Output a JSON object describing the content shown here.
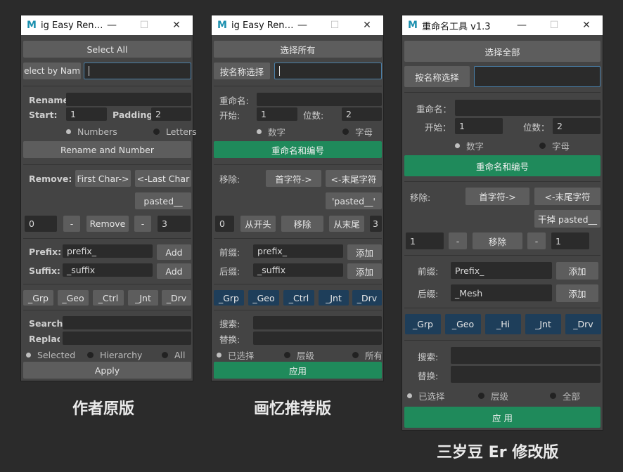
{
  "windows": [
    {
      "title": "ig Easy Ren…",
      "select_all": "Select All",
      "select_by_name": "elect by Nam",
      "rename_label": "Rename:",
      "start_label": "Start:",
      "start_value": "1",
      "padding_label": "Padding",
      "padding_value": "2",
      "opt_numbers": "Numbers",
      "opt_letters": "Letters",
      "rename_number": "Rename and Number",
      "remove_label": "Remove:",
      "first_char": "First Char->",
      "last_char": "<-Last Char",
      "pasted": "pasted__",
      "num_left": "0",
      "minus": "-",
      "remove_btn": "Remove",
      "num_right": "3",
      "prefix_label": "Prefix:",
      "prefix_value": "prefix_",
      "suffix_label": "Suffix:",
      "suffix_value": "_suffix",
      "add": "Add",
      "suffixes": [
        "_Grp",
        "_Geo",
        "_Ctrl",
        "_Jnt",
        "_Drv"
      ],
      "search_label": "Search:",
      "replace_label": "Replac",
      "scope": [
        "Selected",
        "Hierarchy",
        "All"
      ],
      "apply": "Apply",
      "caption": "作者原版"
    },
    {
      "title": "ig Easy Ren…",
      "select_all": "选择所有",
      "select_by_name": "按名称选择",
      "rename_label": "重命名:",
      "start_label": "开始:",
      "start_value": "1",
      "padding_label": "位数:",
      "padding_value": "2",
      "opt_numbers": "数字",
      "opt_letters": "字母",
      "rename_number": "重命名和编号",
      "remove_label": "移除:",
      "first_char": "首字符->",
      "last_char": "<-末尾字符",
      "pasted": "'pasted__'",
      "num_left": "0",
      "from_start": "从开头",
      "remove_btn": "移除",
      "from_end": "从末尾",
      "num_right": "3",
      "prefix_label": "前缀:",
      "prefix_value": "prefix_",
      "suffix_label": "后缀:",
      "suffix_value": "_suffix",
      "add": "添加",
      "suffixes": [
        "_Grp",
        "_Geo",
        "_Ctrl",
        "_Jnt",
        "_Drv"
      ],
      "search_label": "搜索:",
      "replace_label": "替换:",
      "scope": [
        "已选择",
        "层级",
        "所有"
      ],
      "apply": "应用",
      "caption": "画忆推荐版"
    },
    {
      "title": "重命名工具 v1.3",
      "select_all": "选择全部",
      "select_by_name": "按名称选择",
      "rename_label": "重命名：",
      "start_label": "开始：",
      "start_value": "1",
      "padding_label": "位数：",
      "padding_value": "2",
      "opt_numbers": "数字",
      "opt_letters": "字母",
      "rename_number": "重命名和编号",
      "remove_label": "移除:",
      "first_char": "首字符->",
      "last_char": "<-末尾字符",
      "pasted": "干掉 pasted__",
      "num_left": "1",
      "minus": "-",
      "remove_btn": "移除",
      "num_right": "1",
      "prefix_label": "前缀:",
      "prefix_value": "Prefix_",
      "suffix_label": "后缀:",
      "suffix_value": "_Mesh",
      "add": "添加",
      "suffixes": [
        "_Grp",
        "_Geo",
        "_Hi",
        "_Jnt",
        "_Drv"
      ],
      "search_label": "搜索:",
      "replace_label": "替换:",
      "scope": [
        "已选择",
        "层级",
        "全部"
      ],
      "apply": "应 用",
      "caption": "三岁豆 Er 修改版"
    }
  ],
  "window_controls": {
    "minimize": "—",
    "maximize": "☐",
    "close": "✕"
  },
  "logo_glyph": "M",
  "colors": {
    "accent_green": "#1f8a5b",
    "suffix_blue": "#1e3e5a",
    "panel": "#444444",
    "background": "#2b2b2b"
  }
}
